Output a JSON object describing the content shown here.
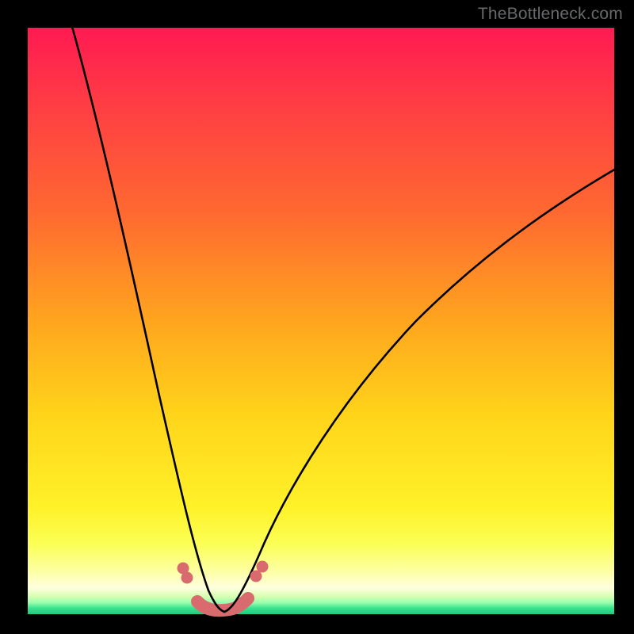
{
  "watermark": {
    "text": "TheBottleneck.com"
  },
  "chart_data": {
    "type": "line",
    "title": "",
    "xlabel": "",
    "ylabel": "",
    "xlim": [
      0,
      100
    ],
    "ylim": [
      0,
      100
    ],
    "gradient_stops": [
      {
        "pos": 0,
        "color": "#ff1a52"
      },
      {
        "pos": 32,
        "color": "#ff6a30"
      },
      {
        "pos": 66,
        "color": "#ffd41a"
      },
      {
        "pos": 92,
        "color": "#fdffa0"
      },
      {
        "pos": 100,
        "color": "#1fc981"
      }
    ],
    "series": [
      {
        "name": "left-branch",
        "x": [
          8,
          10,
          12,
          14,
          16,
          18,
          20,
          22,
          24,
          26,
          28,
          29,
          30,
          31,
          32,
          33
        ],
        "y": [
          100,
          90,
          79,
          68,
          58,
          48,
          39,
          30,
          22,
          15,
          9,
          6,
          4,
          2.5,
          1.5,
          0.8
        ],
        "stroke": "#000000",
        "width": 2.4
      },
      {
        "name": "right-branch",
        "x": [
          33,
          34,
          36,
          38,
          40,
          44,
          48,
          54,
          60,
          68,
          76,
          84,
          92,
          100
        ],
        "y": [
          0.8,
          1.5,
          4,
          8,
          13,
          22,
          30,
          40,
          48,
          56,
          63,
          69,
          73.5,
          77
        ],
        "stroke": "#000000",
        "width": 2.4
      },
      {
        "name": "valley-floor",
        "x": [
          29,
          30,
          31,
          32,
          33,
          34,
          35,
          36,
          37
        ],
        "y": [
          2.2,
          1.2,
          0.6,
          0.5,
          0.5,
          0.6,
          0.9,
          1.4,
          2.2
        ],
        "stroke": "#d96a6e",
        "width": 11,
        "cap": "round"
      },
      {
        "name": "marker-left-upper",
        "type": "dot",
        "x": 26.2,
        "y": 8.2,
        "r": 6.5,
        "fill": "#d96a6e"
      },
      {
        "name": "marker-left-lower",
        "type": "dot",
        "x": 27.0,
        "y": 6.6,
        "r": 6.5,
        "fill": "#d96a6e"
      },
      {
        "name": "marker-right-lower",
        "type": "dot",
        "x": 38.7,
        "y": 6.8,
        "r": 6.5,
        "fill": "#d96a6e"
      },
      {
        "name": "marker-right-upper",
        "type": "dot",
        "x": 39.8,
        "y": 8.4,
        "r": 6.5,
        "fill": "#d96a6e"
      }
    ]
  }
}
